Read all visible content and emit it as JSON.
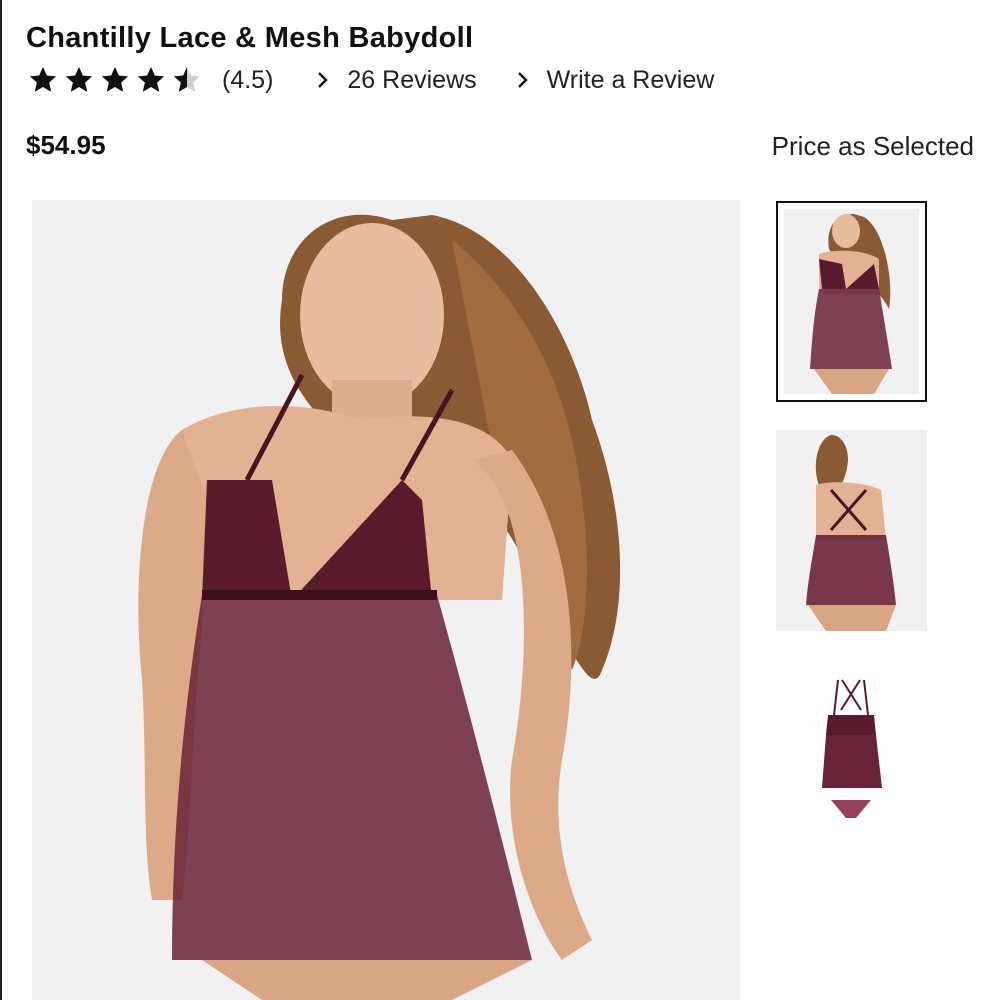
{
  "product": {
    "title": "Chantilly Lace & Mesh Babydoll",
    "rating_stars": 4.5,
    "rating_label": "(4.5)",
    "reviews_link": "26 Reviews",
    "write_review_link": "Write a Review",
    "price": "$54.95",
    "price_note": "Price as Selected"
  },
  "colors": {
    "text": "#111111",
    "garment": "#5a1a2e",
    "image_bg": "#f1f1f1",
    "selected_border": "#111111"
  },
  "gallery": {
    "main_image": "model-front-view",
    "thumbnails": [
      {
        "name": "model-front-thumbnail",
        "selected": true
      },
      {
        "name": "model-back-thumbnail",
        "selected": false
      },
      {
        "name": "product-flatlay-thumbnail",
        "selected": false
      }
    ]
  }
}
